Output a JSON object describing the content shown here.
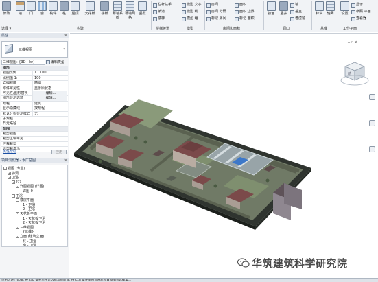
{
  "ribbon": {
    "buttons": [
      {
        "label": "修改",
        "icon": "modify-icon"
      },
      {
        "label": "墙",
        "icon": "wall-icon"
      },
      {
        "label": "门",
        "icon": "door-icon"
      },
      {
        "label": "窗",
        "icon": "window-icon"
      },
      {
        "label": "构件",
        "icon": "component-icon"
      },
      {
        "label": "柱",
        "icon": "column-icon"
      },
      {
        "label": "屋顶",
        "icon": "roof-icon"
      },
      {
        "label": "天花板",
        "icon": "ceiling-icon"
      },
      {
        "label": "楼板",
        "icon": "floor-icon"
      },
      {
        "label": "幕墙系统",
        "icon": "curtain-system-icon"
      },
      {
        "label": "幕墙网格",
        "icon": "curtain-grid-icon"
      },
      {
        "label": "竖梃",
        "icon": "mullion-icon"
      }
    ],
    "small_items": [
      {
        "label": "栏杆扶手",
        "icon": "railing-icon"
      },
      {
        "label": "坡道",
        "icon": "ramp-icon"
      },
      {
        "label": "楼梯",
        "icon": "stair-icon"
      },
      {
        "label": "模型 文字",
        "icon": "model-text-icon"
      },
      {
        "label": "模型 线",
        "icon": "model-line-icon"
      },
      {
        "label": "模型 组",
        "icon": "model-group-icon"
      },
      {
        "label": "房间",
        "icon": "room-icon"
      },
      {
        "label": "房间 分隔",
        "icon": "room-separator-icon"
      },
      {
        "label": "标记 房间",
        "icon": "tag-room-icon"
      },
      {
        "label": "面积",
        "icon": "area-icon"
      },
      {
        "label": "面积 边界",
        "icon": "area-boundary-icon"
      },
      {
        "label": "标记 面积",
        "icon": "tag-area-icon"
      },
      {
        "label": "按面",
        "icon": "by-face-icon"
      },
      {
        "label": "竖井",
        "icon": "shaft-icon"
      },
      {
        "label": "墙",
        "icon": "wall-opening-icon"
      },
      {
        "label": "垂直",
        "icon": "vertical-opening-icon"
      },
      {
        "label": "老虎窗",
        "icon": "dormer-icon"
      },
      {
        "label": "标高",
        "icon": "level-icon"
      },
      {
        "label": "轴网",
        "icon": "grid-icon"
      },
      {
        "label": "设置",
        "icon": "set-icon"
      },
      {
        "label": "显示",
        "icon": "show-icon"
      },
      {
        "label": "参照 平面",
        "icon": "ref-plane-icon"
      },
      {
        "label": "查看器",
        "icon": "viewer-icon"
      }
    ],
    "panels": [
      "选择",
      "构建",
      "楼梯坡道",
      "模型",
      "房间和面积",
      "洞口",
      "基准",
      "工作平面"
    ],
    "select_label": "选择 ▾"
  },
  "properties": {
    "title": "属性",
    "type_name": "三维视图",
    "type_selector": "三维视图: {3D - lw}",
    "edit_type": "编辑类型",
    "rows": [
      {
        "k": "图形",
        "v": "",
        "cat": true
      },
      {
        "k": "视图比例",
        "v": "1 : 100"
      },
      {
        "k": "比例值 1:",
        "v": "100"
      },
      {
        "k": "详细程度",
        "v": "精细"
      },
      {
        "k": "零件可见性",
        "v": "显示原状态"
      },
      {
        "k": "可见性/图形替换",
        "v": "编辑...",
        "btn": true
      },
      {
        "k": "图形显示选项",
        "v": "编辑...",
        "btn": true
      },
      {
        "k": "规程",
        "v": "建筑"
      },
      {
        "k": "显示隐藏线",
        "v": "按规程"
      },
      {
        "k": "默认分析显示样式",
        "v": "无"
      },
      {
        "k": "子规程",
        "v": ""
      },
      {
        "k": "日光路径",
        "v": ""
      },
      {
        "k": "范围",
        "v": "",
        "cat": true
      },
      {
        "k": "裁剪视图",
        "v": ""
      },
      {
        "k": "裁剪区域可见",
        "v": ""
      },
      {
        "k": "注释裁剪",
        "v": ""
      },
      {
        "k": "远剪裁激活",
        "v": ""
      }
    ],
    "help": "属性帮助",
    "apply": "应用"
  },
  "browser": {
    "title": "项目浏览器 - 水厂总图",
    "nodes": [
      {
        "label": "视图 (专业)",
        "box": "-"
      },
      {
        "label": "协调",
        "box": "+"
      },
      {
        "label": "卫浴",
        "box": "-"
      },
      {
        "label": "???",
        "box": "-"
      },
      {
        "label": "详图视图 (详图)",
        "box": "-"
      },
      {
        "label": "详图 0",
        "box": ""
      },
      {
        "label": "卫浴",
        "box": "-"
      },
      {
        "label": "楼层平面",
        "box": "-"
      },
      {
        "label": "1 - 卫浴",
        "box": ""
      },
      {
        "label": "2 - 卫浴",
        "box": ""
      },
      {
        "label": "天花板平面",
        "box": "-"
      },
      {
        "label": "1 - 天花板卫浴",
        "box": ""
      },
      {
        "label": "2 - 天花板卫浴",
        "box": ""
      },
      {
        "label": "三维视图",
        "box": "-"
      },
      {
        "label": "{三维}",
        "box": ""
      },
      {
        "label": "立面 (建筑立面)",
        "box": "-"
      },
      {
        "label": "北 - 卫浴",
        "box": ""
      },
      {
        "label": "南 - 卫浴",
        "box": ""
      }
    ]
  },
  "viewcube": {
    "face_label": "前"
  },
  "status_text": "单击可进行选择; 按 Tab 键并单击可选择其他项目; 按 Ctrl 键并单击可将新项目添加到选择集...",
  "watermark": {
    "text": "华筑建筑科学研究院",
    "icon": "wechat-icon"
  },
  "colors": {
    "site_base": "#2f342f",
    "terrain": "#707a66",
    "roof": "#7b4a4a",
    "ribbon_bg": "#f1f3f6"
  }
}
